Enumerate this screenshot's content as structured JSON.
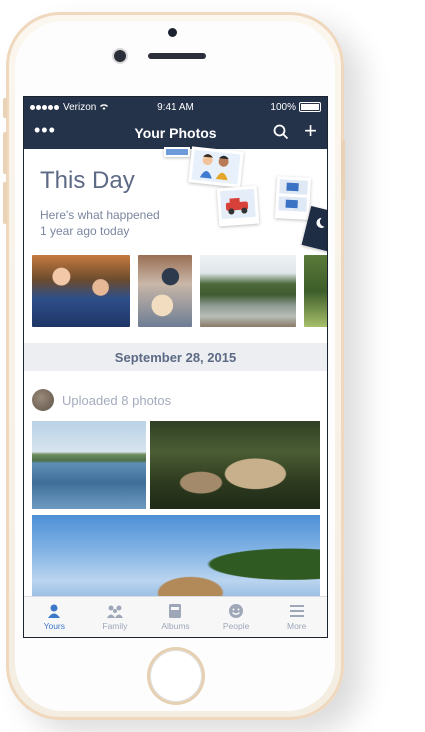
{
  "status": {
    "carrier": "Verizon",
    "time": "9:41 AM",
    "battery": "100%"
  },
  "nav": {
    "title": "Your Photos",
    "more_icon": "ellipsis-icon",
    "search_icon": "search-icon",
    "add_icon": "plus-icon"
  },
  "thisday": {
    "title": "This Day",
    "subtitle_line1": "Here's what happened",
    "subtitle_line2": "1 year ago today"
  },
  "section": {
    "date": "September 28, 2015",
    "upload_text": "Uploaded 8 photos"
  },
  "tabs": [
    {
      "label": "Yours",
      "icon": "person-icon",
      "active": true
    },
    {
      "label": "Family",
      "icon": "family-icon",
      "active": false
    },
    {
      "label": "Albums",
      "icon": "album-icon",
      "active": false
    },
    {
      "label": "People",
      "icon": "smiley-icon",
      "active": false
    },
    {
      "label": "More",
      "icon": "menu-icon",
      "active": false
    }
  ],
  "colors": {
    "nav_bg": "#24334a",
    "accent": "#3b79c8",
    "muted_text": "#7a86a0"
  }
}
